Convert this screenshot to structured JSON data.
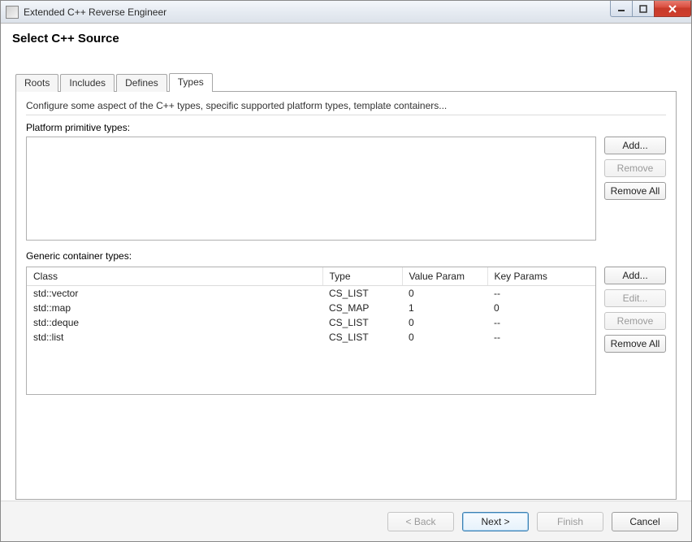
{
  "window": {
    "title": "Extended C++ Reverse Engineer"
  },
  "header": {
    "title": "Select C++ Source"
  },
  "tabs": {
    "items": [
      {
        "label": "Roots"
      },
      {
        "label": "Includes"
      },
      {
        "label": "Defines"
      },
      {
        "label": "Types"
      }
    ],
    "active_index": 3
  },
  "types_panel": {
    "intro": "Configure some aspect of the C++ types, specific supported platform types, template containers...",
    "platform_label": "Platform primitive types:",
    "generic_label": "Generic container types:",
    "platform_buttons": {
      "add": "Add...",
      "remove": "Remove",
      "remove_all": "Remove All"
    },
    "generic_buttons": {
      "add": "Add...",
      "edit": "Edit...",
      "remove": "Remove",
      "remove_all": "Remove All"
    },
    "table": {
      "headers": {
        "class": "Class",
        "type": "Type",
        "value_param": "Value Param",
        "key_params": "Key Params"
      },
      "rows": [
        {
          "class": "std::vector",
          "type": "CS_LIST",
          "value_param": "0",
          "key_params": "--"
        },
        {
          "class": "std::map",
          "type": "CS_MAP",
          "value_param": "1",
          "key_params": "0"
        },
        {
          "class": "std::deque",
          "type": "CS_LIST",
          "value_param": "0",
          "key_params": "--"
        },
        {
          "class": "std::list",
          "type": "CS_LIST",
          "value_param": "0",
          "key_params": "--"
        }
      ]
    }
  },
  "footer": {
    "back": "< Back",
    "next": "Next >",
    "finish": "Finish",
    "cancel": "Cancel"
  }
}
